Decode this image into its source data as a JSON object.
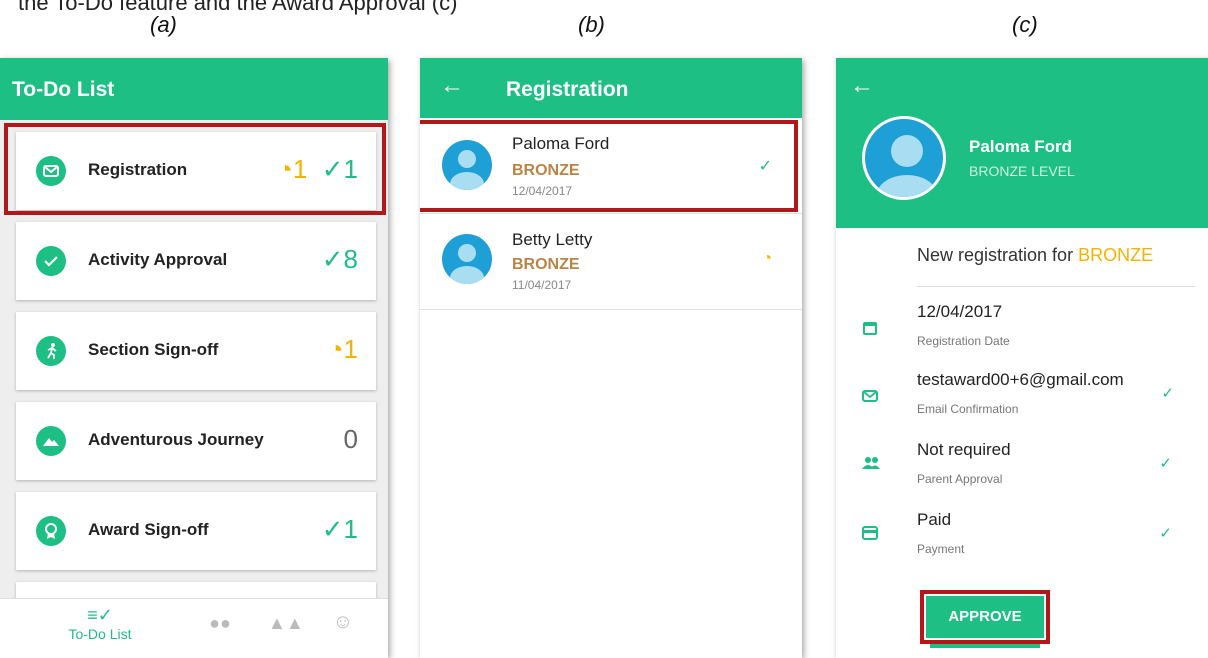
{
  "caption_top": "the To-Do feature and the Award Approval (c)",
  "labels": {
    "a": "(a)",
    "b": "(b)",
    "c": "(c)"
  },
  "colors": {
    "accent": "#1dbf85",
    "pending": "#f5b301",
    "highlight": "#b2171a",
    "level": "#b98544"
  },
  "panel_a": {
    "title": "To-Do List",
    "items": [
      {
        "label": "Registration",
        "icon": "mail-icon",
        "pending": "1",
        "done": "1"
      },
      {
        "label": "Activity Approval",
        "icon": "check-icon",
        "pending": "",
        "done": "8"
      },
      {
        "label": "Section Sign-off",
        "icon": "runner-icon",
        "pending": "1",
        "done": ""
      },
      {
        "label": "Adventurous Journey",
        "icon": "mountain-icon",
        "pending": "",
        "done": "",
        "zero": "0"
      },
      {
        "label": "Award Sign-off",
        "icon": "award-icon",
        "pending": "",
        "done": "1"
      }
    ],
    "bottom_nav": {
      "active_label": "To-Do List"
    }
  },
  "panel_b": {
    "title": "Registration",
    "rows": [
      {
        "name": "Paloma Ford",
        "level": "BRONZE",
        "date": "12/04/2017",
        "status": "approved"
      },
      {
        "name": "Betty Letty",
        "level": "BRONZE",
        "date": "11/04/2017",
        "status": "pending"
      }
    ]
  },
  "panel_c": {
    "name": "Paloma Ford",
    "level": "BRONZE LEVEL",
    "heading_prefix": "New registration for ",
    "heading_level": "BRONZE",
    "details": [
      {
        "value": "12/04/2017",
        "label": "Registration Date",
        "icon": "calendar-icon",
        "check": false
      },
      {
        "value": "testaward00+6@gmail.com",
        "label": "Email Confirmation",
        "icon": "mail-icon",
        "check": true
      },
      {
        "value": "Not required",
        "label": "Parent Approval",
        "icon": "people-icon",
        "check": true
      },
      {
        "value": "Paid",
        "label": "Payment",
        "icon": "card-icon",
        "check": true
      }
    ],
    "approve_label": "APPROVE"
  }
}
